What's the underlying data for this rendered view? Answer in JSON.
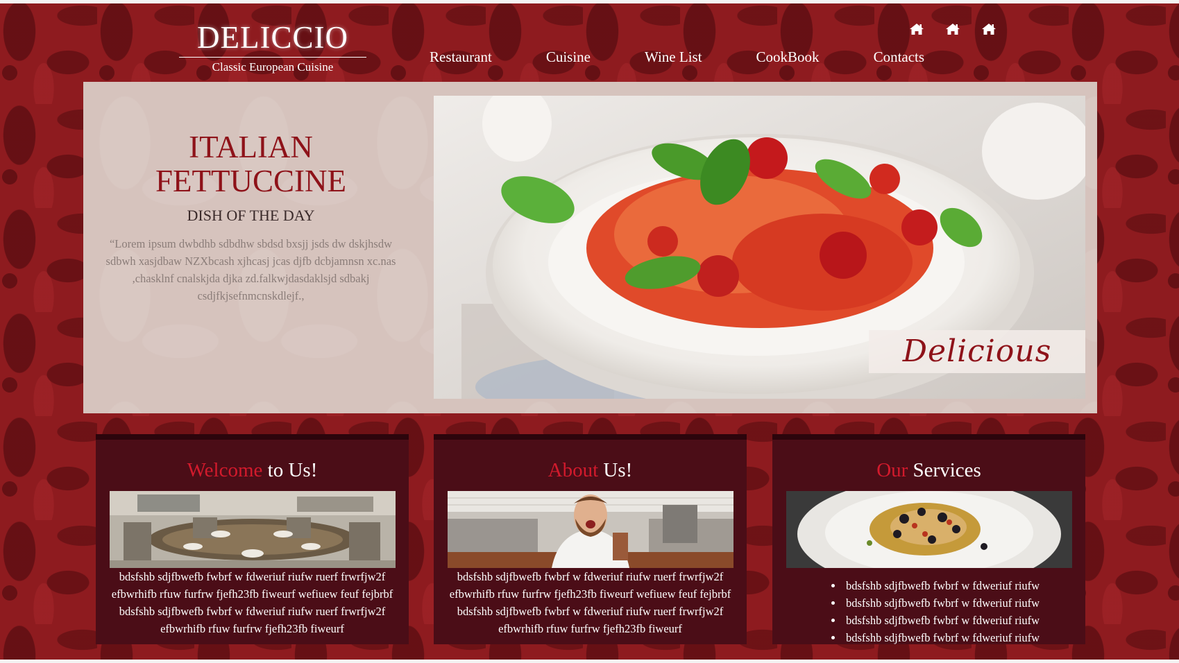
{
  "brand": {
    "title": "DELICCIO",
    "subtitle": "Classic European Cuisine"
  },
  "social_icons": [
    "home-icon",
    "home-icon",
    "home-icon"
  ],
  "nav": [
    {
      "label": "Restaurant"
    },
    {
      "label": "Cuisine"
    },
    {
      "label": "Wine List"
    },
    {
      "label": "CookBook"
    },
    {
      "label": "Contacts"
    }
  ],
  "hero": {
    "title_line1": "ITALIAN",
    "title_line2": "FETTUCCINE",
    "subtitle": "DISH OF THE DAY",
    "quote": "“Lorem ipsum dwbdhb sdbdhw sbdsd bxsjj jsds dw dskjhsdw sdbwh xasjdbaw NZXbcash xjhcasj jcas djfb dcbjamnsn xc.nas ,chasklnf cnalskjda djka zd.falkwjdasdaklsjd sdbakj csdjfkjsefnmcnskdlejf.,",
    "image_caption": "Delicious"
  },
  "cards": [
    {
      "title_accent": "Welcome",
      "title_rest": " to Us!",
      "body": "bdsfshb sdjfbwefb fwbrf w fdweriuf riufw ruerf frwrfjw2f efbwrhifb rfuw furfrw fjefh23fb fiweurf wefiuew feuf fejbrbf bdsfshb sdjfbwefb fwbrf w fdweriuf riufw ruerf frwrfjw2f efbwrhifb rfuw furfrw fjefh23fb fiweurf"
    },
    {
      "title_accent": "About",
      "title_rest": " Us!",
      "body": "bdsfshb sdjfbwefb fwbrf w fdweriuf riufw ruerf frwrfjw2f efbwrhifb rfuw furfrw fjefh23fb fiweurf wefiuew feuf fejbrbf bdsfshb sdjfbwefb fwbrf w fdweriuf riufw ruerf frwrfjw2f efbwrhifb rfuw furfrw fjefh23fb fiweurf"
    },
    {
      "title_accent": "Our",
      "title_rest": " Services",
      "list": [
        "bdsfshb sdjfbwefb fwbrf w fdweriuf riufw",
        "bdsfshb sdjfbwefb fwbrf w fdweriuf riufw",
        "bdsfshb sdjfbwefb fwbrf w fdweriuf riufw",
        "bdsfshb sdjfbwefb fwbrf w fdweriuf riufw"
      ]
    }
  ],
  "colors": {
    "background": "#8e1b1f",
    "hero_panel": "#d6c3bd",
    "accent_red": "#d21a2c",
    "card_bg": "#4b0d17",
    "title_red": "#8e1219"
  }
}
